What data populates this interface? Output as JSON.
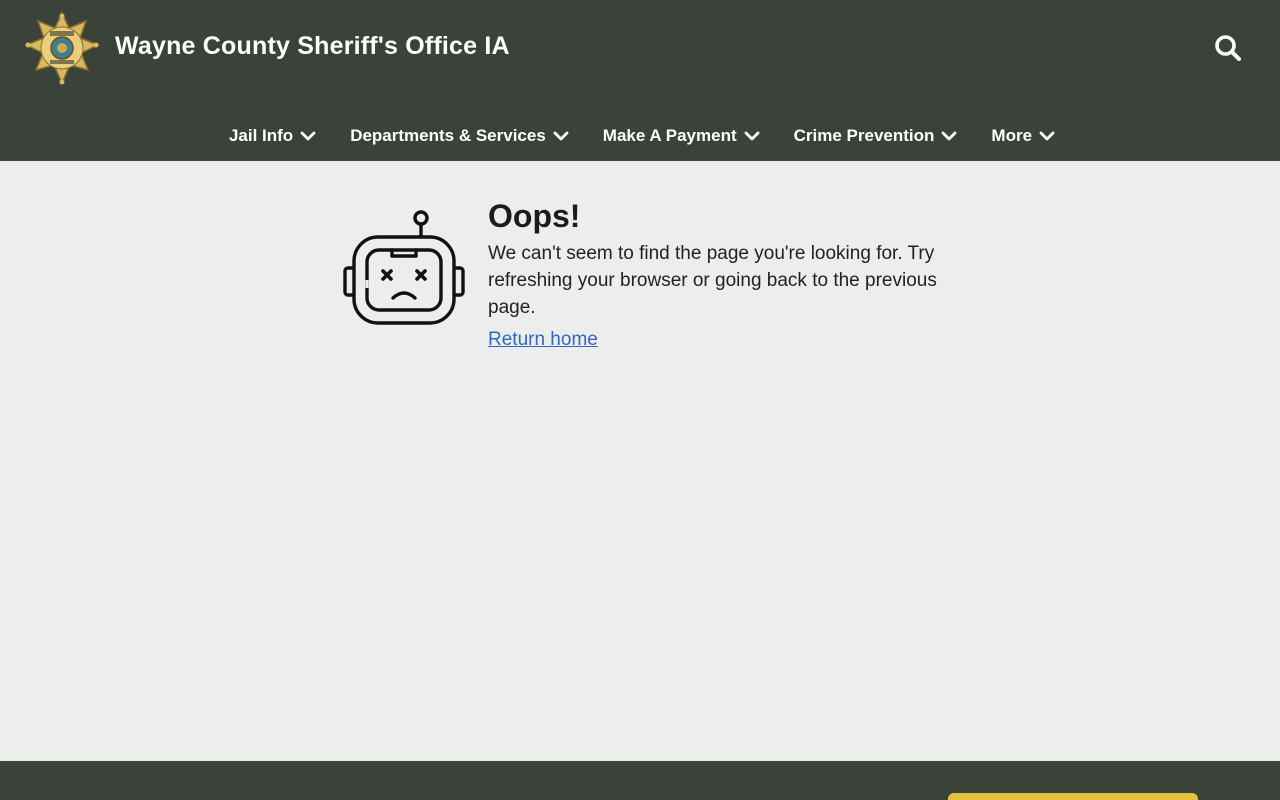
{
  "header": {
    "site_title": "Wayne County Sheriff's Office IA",
    "background_color": "#3b423a",
    "search_icon": "search-icon",
    "logo_icon": "sheriff-star-badge"
  },
  "nav": {
    "items": [
      {
        "label": "Jail Info"
      },
      {
        "label": "Departments & Services"
      },
      {
        "label": "Make A Payment"
      },
      {
        "label": "Crime Prevention"
      },
      {
        "label": "More"
      }
    ]
  },
  "error": {
    "title": "Oops!",
    "message": "We can't seem to find the page you're looking for. Try refreshing your browser or going back to the previous page.",
    "link_label": "Return home",
    "illustration_icon": "sad-robot-icon",
    "link_color": "#2f67c7"
  },
  "footer": {
    "background_color": "#3b423a",
    "button_color": "#e6c23e"
  }
}
